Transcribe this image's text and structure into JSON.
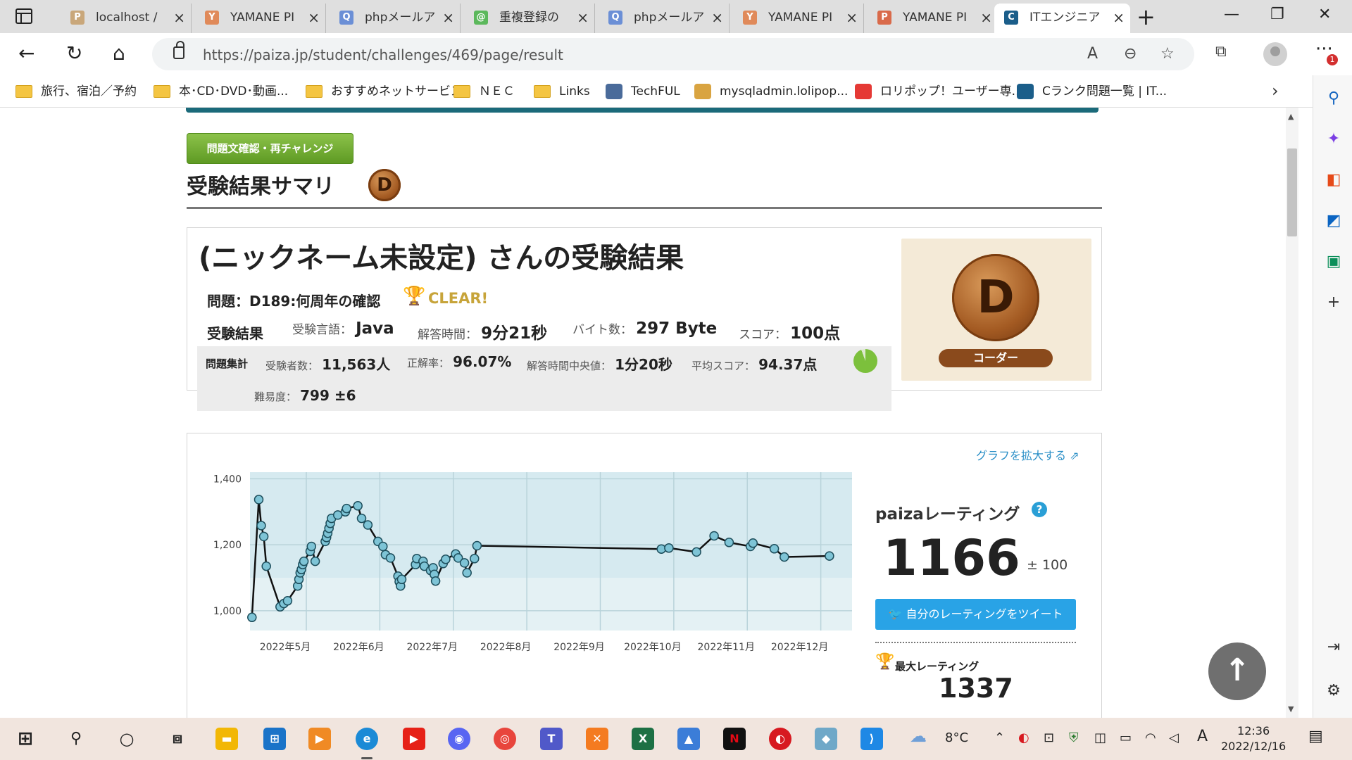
{
  "browser": {
    "tabs": [
      {
        "label": "localhost /",
        "icon_color": "#c9a77a",
        "icon_text": "P"
      },
      {
        "label": "YAMANE PI",
        "icon_color": "#e08a5a",
        "icon_text": "Y"
      },
      {
        "label": "phpメールア",
        "icon_color": "#6b8fd6",
        "icon_text": "Q"
      },
      {
        "label": "重複登録の",
        "icon_color": "#5cb85c",
        "icon_text": "@"
      },
      {
        "label": "phpメールア",
        "icon_color": "#6b8fd6",
        "icon_text": "Q"
      },
      {
        "label": "YAMANE PI",
        "icon_color": "#e08a5a",
        "icon_text": "Y"
      },
      {
        "label": "YAMANE PI",
        "icon_color": "#d96a4a",
        "icon_text": "P"
      },
      {
        "label": "ITエンジニア",
        "icon_color": "#1b5e8a",
        "icon_text": "C",
        "active": true
      }
    ],
    "url": "https://paiza.jp/student/challenges/469/page/result",
    "bookmarks": [
      {
        "label": "旅行、宿泊／予約",
        "type": "folder"
      },
      {
        "label": "本･CD･DVD･動画...",
        "type": "folder"
      },
      {
        "label": "おすすめネットサービス",
        "type": "folder"
      },
      {
        "label": "ＮＥＣ",
        "type": "folder"
      },
      {
        "label": "Links",
        "type": "folder"
      },
      {
        "label": "TechFUL",
        "type": "site",
        "color": "#4a6b9a"
      },
      {
        "label": "mysqladmin.lolipop...",
        "type": "site",
        "color": "#d9a441"
      },
      {
        "label": "ロリポップ！ユーザー専...",
        "type": "site",
        "color": "#e53935"
      },
      {
        "label": "Cランク問題一覧 | IT...",
        "type": "site",
        "color": "#1b5e8a"
      }
    ],
    "notification_count": "1"
  },
  "page": {
    "retry_button": "問題文確認・再チャレンジ",
    "summary_title": "受験結果サマリ",
    "rank_letter": "D",
    "result_heading": "(ニックネーム未設定) さんの受験結果",
    "problem": "問題：D189:何周年の確認",
    "clear_text": "CLEAR!",
    "result_label": "受験結果",
    "language_label": "受験言語：",
    "language": "Java",
    "time_label": "解答時間：",
    "time": "9分21秒",
    "bytes_label": "バイト数：",
    "bytes": "297 Byte",
    "score_label": "スコア：",
    "score": "100点",
    "stats_label": "問題集計",
    "examinees_label": "受験者数：",
    "examinees": "11,563人",
    "accuracy_label": "正解率：",
    "accuracy": "96.07%",
    "median_label": "解答時間中央値：",
    "median": "1分20秒",
    "avg_label": "平均スコア：",
    "avg": "94.37点",
    "avg_fraction": 0.9437,
    "difficulty_label": "難易度：",
    "difficulty": "799 ±6",
    "rank_name": "コーダー"
  },
  "graph": {
    "enlarge_link": "グラフを拡大する",
    "rating_title": "paizaレーティング",
    "rating": "1166",
    "rating_pm": "± 100",
    "tweet_button": "自分のレーティングをツイート",
    "max_label": "最大レーティング",
    "max_value": "1337"
  },
  "chart_data": {
    "type": "line",
    "ylim": [
      940,
      1420
    ],
    "yticks": [
      1000,
      1200,
      1400
    ],
    "ytick_labels": [
      "1,000",
      "1,200",
      "1,400"
    ],
    "x_labels": [
      "2022年5月",
      "2022年6月",
      "2022年7月",
      "2022年8月",
      "2022年9月",
      "2022年10月",
      "2022年11月",
      "2022年12月"
    ],
    "series": [
      {
        "points": [
          [
            0.08,
            980
          ],
          [
            0.35,
            1337
          ],
          [
            0.45,
            1258
          ],
          [
            0.55,
            1225
          ],
          [
            0.65,
            1135
          ],
          [
            1.2,
            1012
          ],
          [
            1.35,
            1022
          ],
          [
            1.5,
            1030
          ],
          [
            1.9,
            1075
          ],
          [
            1.95,
            1095
          ],
          [
            2.0,
            1115
          ],
          [
            2.05,
            1125
          ],
          [
            2.1,
            1140
          ],
          [
            2.15,
            1150
          ],
          [
            2.4,
            1180
          ],
          [
            2.45,
            1195
          ],
          [
            2.6,
            1150
          ],
          [
            3.0,
            1210
          ],
          [
            3.05,
            1222
          ],
          [
            3.1,
            1235
          ],
          [
            3.15,
            1250
          ],
          [
            3.2,
            1265
          ],
          [
            3.25,
            1280
          ],
          [
            3.5,
            1290
          ],
          [
            3.8,
            1300
          ],
          [
            3.85,
            1310
          ],
          [
            4.3,
            1318
          ],
          [
            4.45,
            1280
          ],
          [
            4.7,
            1260
          ],
          [
            5.1,
            1210
          ],
          [
            5.3,
            1195
          ],
          [
            5.4,
            1170
          ],
          [
            5.6,
            1160
          ],
          [
            5.9,
            1105
          ],
          [
            5.95,
            1088
          ],
          [
            6.0,
            1075
          ],
          [
            6.05,
            1095
          ],
          [
            6.6,
            1140
          ],
          [
            6.65,
            1158
          ],
          [
            6.9,
            1150
          ],
          [
            6.95,
            1135
          ],
          [
            7.2,
            1122
          ],
          [
            7.3,
            1130
          ],
          [
            7.35,
            1110
          ],
          [
            7.4,
            1090
          ],
          [
            7.7,
            1143
          ],
          [
            7.8,
            1156
          ],
          [
            8.2,
            1172
          ],
          [
            8.3,
            1160
          ],
          [
            8.55,
            1145
          ],
          [
            8.65,
            1115
          ],
          [
            8.95,
            1158
          ],
          [
            9.05,
            1197
          ],
          [
            16.4,
            1187
          ],
          [
            16.7,
            1190
          ],
          [
            17.8,
            1178
          ],
          [
            18.5,
            1227
          ],
          [
            19.1,
            1207
          ],
          [
            19.95,
            1195
          ],
          [
            20.05,
            1205
          ],
          [
            20.9,
            1188
          ],
          [
            21.3,
            1163
          ],
          [
            23.1,
            1166
          ]
        ]
      }
    ]
  }
}
